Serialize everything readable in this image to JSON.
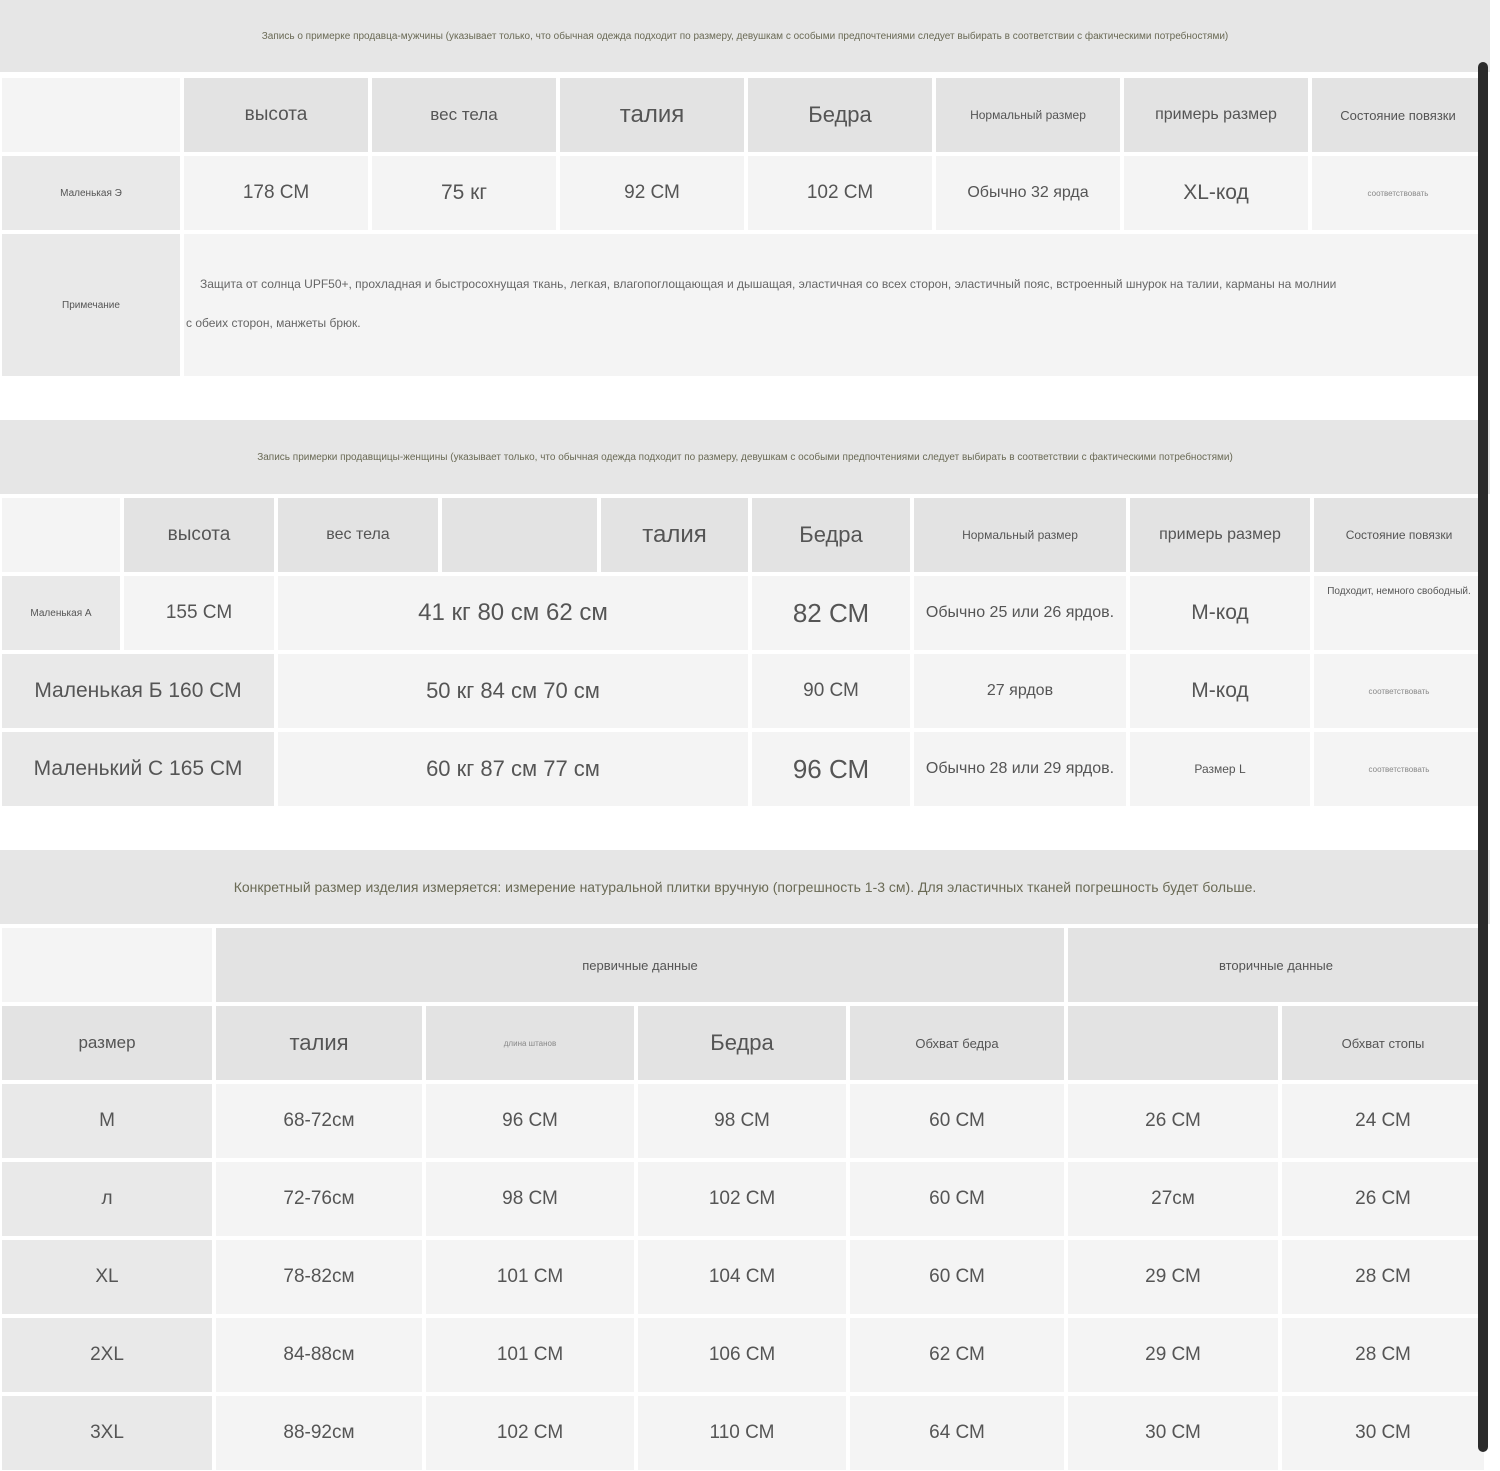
{
  "male": {
    "banner": "Запись о примерке продавца-мужчины (указывает только, что обычная одежда подходит по размеру, девушкам с особыми предпочтениями следует выбирать в соответствии с фактическими потребностями)",
    "headers": [
      "высота",
      "вес тела",
      "талия",
      "Бедра",
      "Нормальный размер",
      "примерь размер",
      "Состояние повязки"
    ],
    "row": {
      "label": "Маленькая Э",
      "values": [
        "178 СМ",
        "75 кг",
        "92 СМ",
        "102 СМ",
        "Обычно 32 ярда",
        "XL-код",
        "соответствовать"
      ]
    },
    "note": {
      "label": "Примечание",
      "line1": "Защита от солнца UPF50+, прохладная и быстросохнущая ткань, легкая, влагопоглощающая и дышащая, эластичная со всех сторон, эластичный пояс, встроенный шнурок на талии, карманы на молнии",
      "line2": "с обеих сторон, манжеты брюк."
    }
  },
  "female": {
    "banner": "Запись примерки продавщицы-женщины (указывает только, что обычная одежда подходит по размеру, девушкам с особыми предпочтениями следует выбирать в соответствии с фактическими потребностями)",
    "headers": [
      "высота",
      "вес тела",
      "",
      "талия",
      "Бедра",
      "Нормальный размер",
      "примерь размер",
      "Состояние повязки"
    ],
    "rows": [
      {
        "label": "Маленькая А",
        "height": "155 СМ",
        "merged": "41 кг 80 см 62 см",
        "hips": "82 СМ",
        "normal": "Обычно 25 или 26 ярдов.",
        "tried": "М-код",
        "fit": "Подходит, немного свободный."
      },
      {
        "label": "Маленькая Б 160 СМ",
        "merged": "50 кг 84 см 70 см",
        "hips": "90 СМ",
        "normal": "27 ярдов",
        "tried": "М-код",
        "fit": "соответствовать"
      },
      {
        "label": "Маленький С 165 СМ",
        "merged": "60 кг 87 см 77 см",
        "hips": "96 СМ",
        "normal": "Обычно 28 или 29 ярдов.",
        "tried": "Размер L",
        "fit": "соответствовать"
      }
    ]
  },
  "product": {
    "banner": "Конкретный размер изделия измеряется: измерение натуральной плитки вручную (погрешность 1-3 см). Для эластичных тканей погрешность будет больше.",
    "group_primary": "первичные данные",
    "group_secondary": "вторичные данные",
    "headers": [
      "размер",
      "талия",
      "длина штанов",
      "Бедра",
      "Обхват бедра",
      "",
      "Обхват стопы"
    ],
    "rows": [
      [
        "M",
        "68-72см",
        "96 СМ",
        "98 СМ",
        "60 СМ",
        "26 СМ",
        "24 СМ"
      ],
      [
        "л",
        "72-76см",
        "98 СМ",
        "102 СМ",
        "60 СМ",
        "27см",
        "26 СМ"
      ],
      [
        "XL",
        "78-82см",
        "101 СМ",
        "104 СМ",
        "60 СМ",
        "29 СМ",
        "28 СМ"
      ],
      [
        "2XL",
        "84-88см",
        "101 СМ",
        "106 СМ",
        "62 СМ",
        "29 СМ",
        "28 СМ"
      ],
      [
        "3XL",
        "88-92см",
        "102 СМ",
        "110 СМ",
        "64 СМ",
        "30 СМ",
        "30 СМ"
      ]
    ]
  }
}
